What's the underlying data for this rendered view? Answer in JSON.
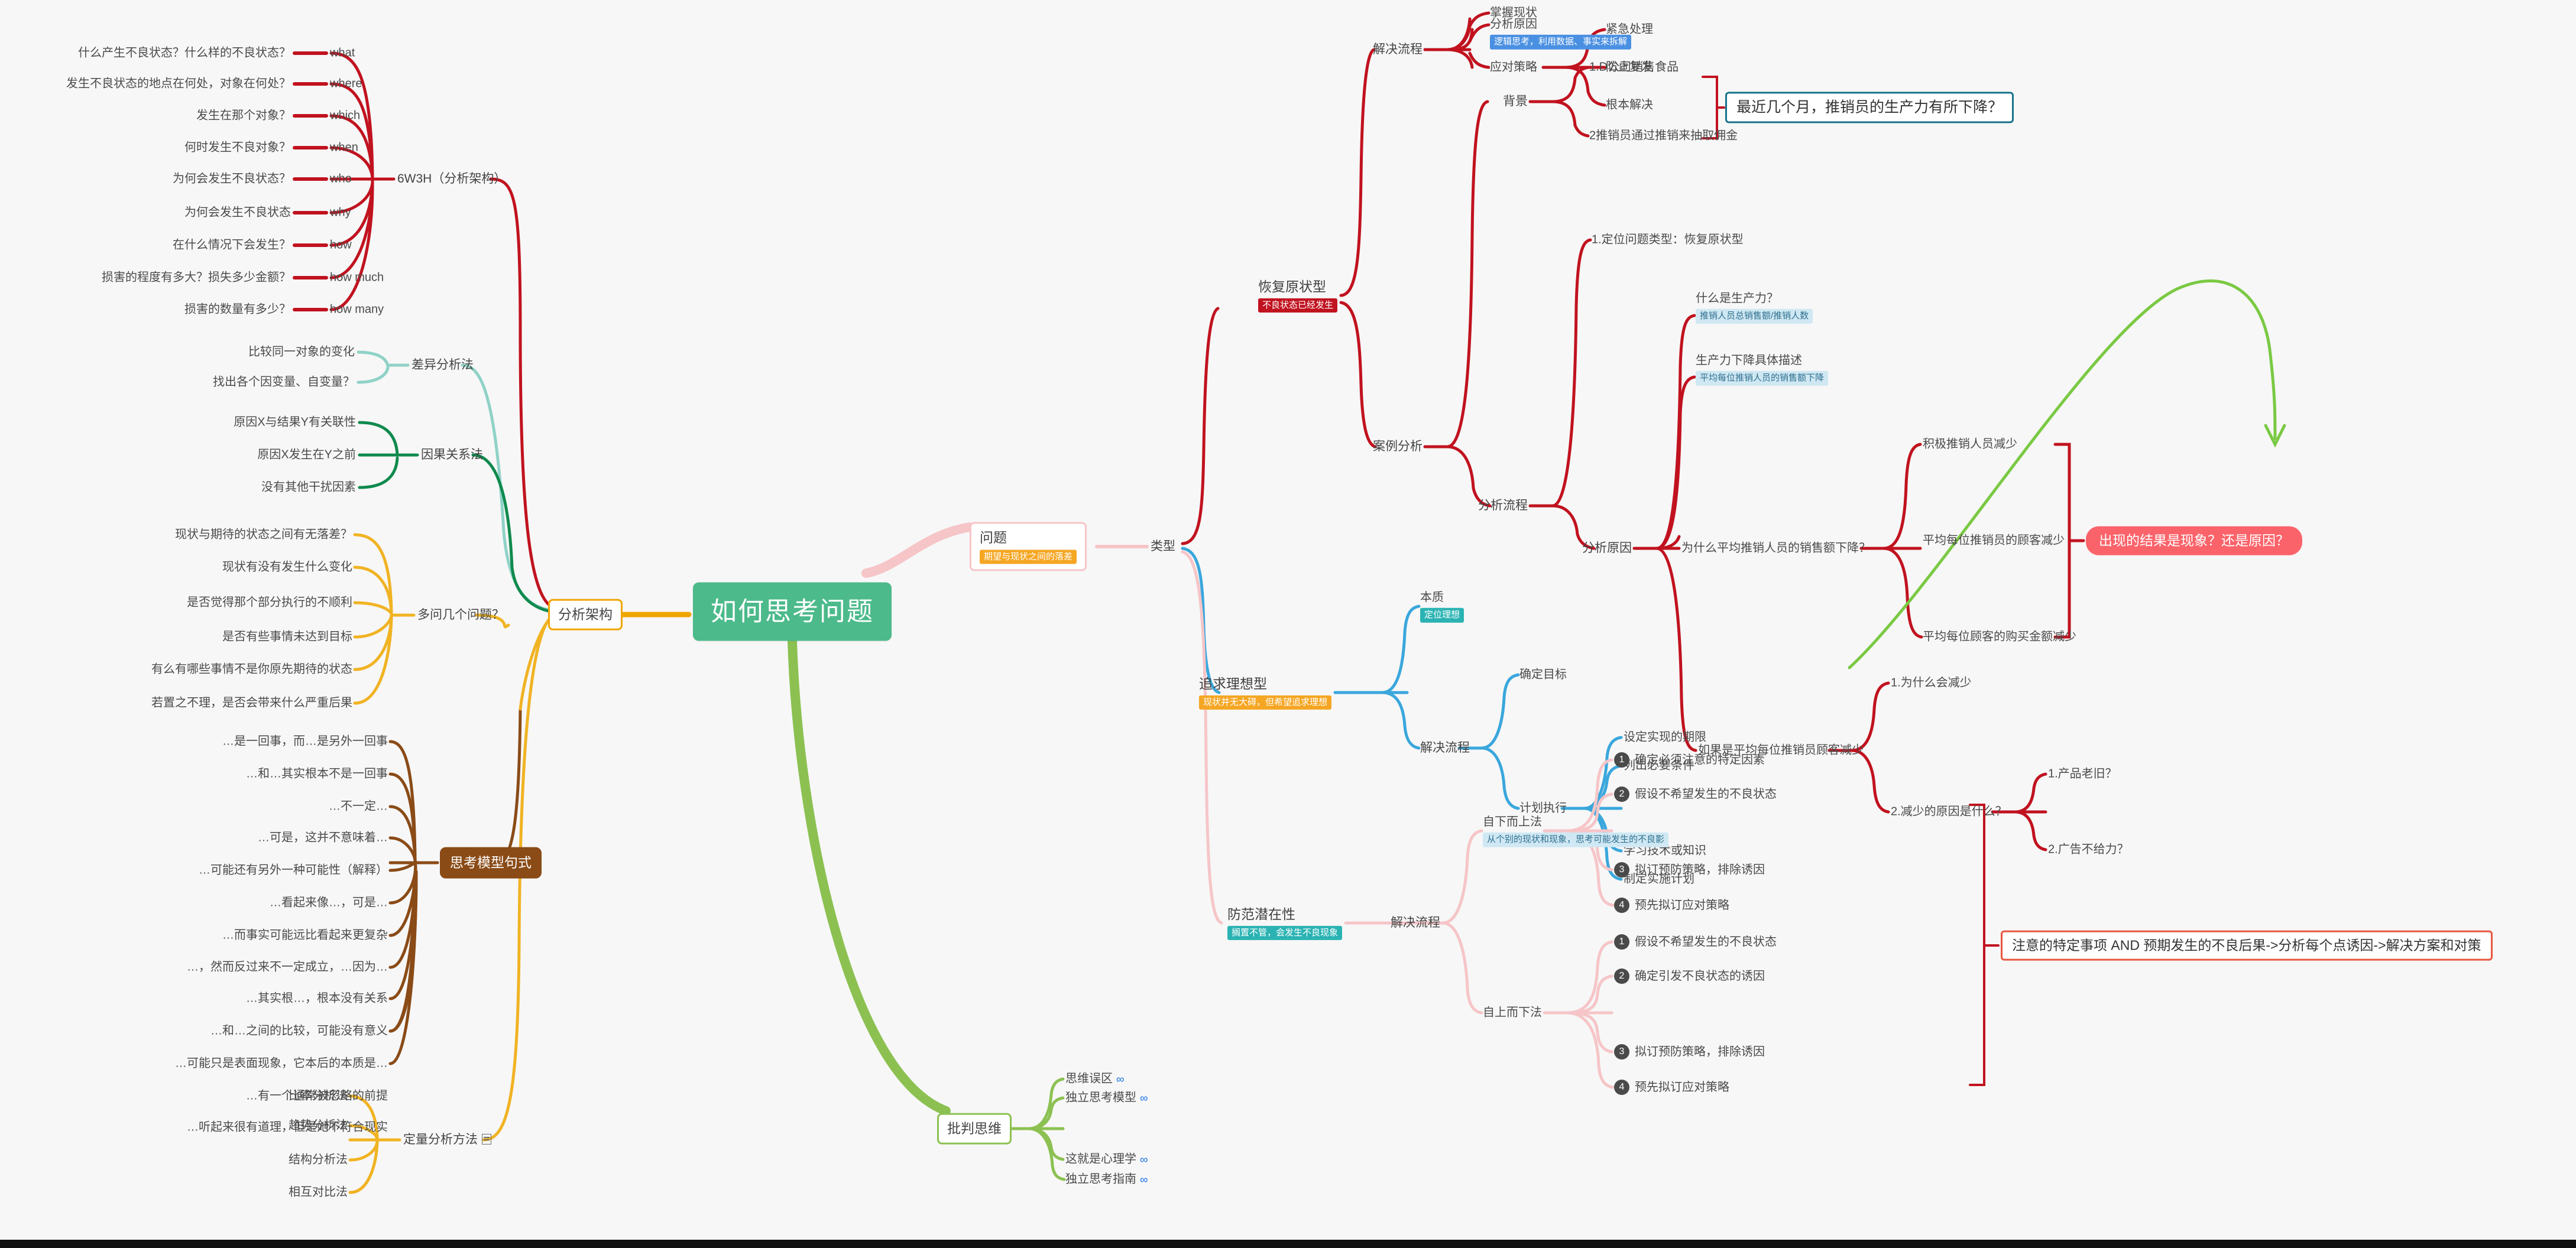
{
  "root": {
    "label": "如何思考问题",
    "color": "#4cba8b"
  },
  "branches": {
    "analysis_framework": {
      "label": "分析架构",
      "color": "#f0a500",
      "groups": [
        {
          "label": "6W3H（分析架构）",
          "color": "#c1121f",
          "items": [
            {
              "key": "what",
              "question": "什么产生不良状态？什么样的不良状态？"
            },
            {
              "key": "where",
              "question": "发生不良状态的地点在何处，对象在何处？"
            },
            {
              "key": "which",
              "question": "发生在那个对象？"
            },
            {
              "key": "when",
              "question": "何时发生不良对象？"
            },
            {
              "key": "who",
              "question": "为何会发生不良状态？"
            },
            {
              "key": "why",
              "question": "为何会发生不良状态"
            },
            {
              "key": "how",
              "question": "在什么情况下会发生？"
            },
            {
              "key": "how much",
              "question": "损害的程度有多大？损失多少金额？"
            },
            {
              "key": "how many",
              "question": "损害的数量有多少？"
            }
          ]
        },
        {
          "label": "差异分析法",
          "color": "#8fd2c7",
          "items": [
            "比较同一对象的变化",
            "找出各个因变量、自变量？"
          ]
        },
        {
          "label": "因果关系法",
          "color": "#0f8a4d",
          "items": [
            "原因X与结果Y有关联性",
            "原因X发生在Y之前",
            "没有其他干扰因素"
          ]
        },
        {
          "label": "多问几个问题？",
          "color": "#f0b323",
          "items": [
            "现状与期待的状态之间有无落差？",
            "现状有没有发生什么变化",
            "是否觉得那个部分执行的不顺利",
            "是否有些事情未达到目标",
            "有么有哪些事情不是你原先期待的状态",
            "若置之不理，是否会带来什么严重后果"
          ]
        },
        {
          "label": "思考模型句式",
          "color": "#8a4b17",
          "items": [
            "…是一回事，而…是另外一回事",
            "…和…其实根本不是一回事",
            "…不一定…",
            "…可是，这并不意味着…",
            "…可能还有另外一种可能性（解释）",
            "…看起来像…，可是…",
            "…而事实可能远比看起来更复杂",
            "…，然而反过来不一定成立，…因为…",
            "…其实根…，根本没有关系",
            "…和…之间的比较，可能没有意义",
            "…可能只是表面现象，它本后的本质是…",
            "…有一个通常被忽略的前提",
            "…听起来很有道理，但是她不符合现实"
          ]
        },
        {
          "label": "定量分析方法",
          "color": "#f0b323",
          "has_list_icon": true,
          "items": [
            "比率分析法",
            "趋势分析法",
            "结构分析法",
            "相互对比法"
          ]
        }
      ]
    },
    "problem": {
      "label": "问题",
      "tag": "期望与现状之间的落差",
      "tag_color": "#f5a623",
      "color": "#f6c5c8",
      "type_label": "类型",
      "types": [
        {
          "label": "恢复原状型",
          "tag": "不良状态已经发生",
          "tag_color": "#c1121f",
          "color": "#c1121f",
          "solve_process": {
            "label": "解决流程",
            "steps": [
              {
                "label": "掌握现状"
              },
              {
                "label": "分析原因",
                "tag": "逻辑思考，利用数据、事实来拆解",
                "tag_color": "#4a90e2"
              },
              {
                "label": "应对策略",
                "children": [
                  "紧急处理",
                  "防止复发",
                  "根本解决"
                ]
              }
            ]
          },
          "case_study": {
            "label": "案例分析",
            "background": {
              "label": "背景",
              "items": [
                "1.D公司销售食品",
                "2推销员通过推销来抽取佣金"
              ],
              "callout": "最近几个月，推销员的生产力有所下降？",
              "callout_color": "#17728c"
            },
            "analysis_flow": {
              "label": "分析流程",
              "step1": "1.定位问题类型：恢复原状型",
              "cause_analysis": {
                "label": "分析原因",
                "items": [
                  {
                    "label": "什么是生产力？",
                    "tag": "推销人员总销售额/推销人数",
                    "tag_color": "#cfe8f3"
                  },
                  {
                    "label": "生产力下降具体描述",
                    "tag": "平均每位推销人员的销售额下降",
                    "tag_color": "#cfe8f3"
                  },
                  {
                    "label": "为什么平均推销人员的销售额下降？",
                    "children": [
                      "积极推销人员减少",
                      "平均每位推销员的顾客减少",
                      "平均每位顾客的购买金额减少"
                    ]
                  },
                  {
                    "label": "如果是平均每位推销员顾客减少",
                    "children_numbered": [
                      "1.为什么会减少",
                      "2.减少的原因是什么？"
                    ],
                    "sub_children": [
                      "1.产品老旧？",
                      "2.广告不给力？"
                    ]
                  }
                ],
                "pill_note": "出现的结果是现象？还是原因？",
                "pill_color": "#fb636a"
              }
            }
          }
        },
        {
          "label": "追求理想型",
          "tag": "现状并无大碍，但希望追求理想",
          "tag_color": "#f5a623",
          "color": "#3aa7dc",
          "essence": {
            "label": "本质",
            "tag": "定位理想",
            "tag_color": "#2bb3b3"
          },
          "solve_process": {
            "label": "解决流程",
            "steps": [
              {
                "label": "确定目标"
              },
              {
                "label": "计划执行",
                "children": [
                  "设定实现的期限",
                  "列出必要条件",
                  "学习技术或知识",
                  "制定实施计划"
                ]
              }
            ]
          }
        },
        {
          "label": "防范潜在性",
          "tag": "搁置不管，会发生不良现象",
          "tag_color": "#2bb3b3",
          "color": "#f6c5c8",
          "solve_process": {
            "label": "解决流程",
            "methods": [
              {
                "label": "自下而上法",
                "tag": "从个别的现状和现象，思考可能发生的不良影",
                "tag_color": "#cfe8f3",
                "steps": [
                  "确定必须注意的特定因素",
                  "假设不希望发生的不良状态",
                  "拟订预防策略，排除诱因",
                  "预先拟订应对策略"
                ]
              },
              {
                "label": "自上而下法",
                "steps": [
                  "假设不希望发生的不良状态",
                  "确定引发不良状态的诱因",
                  "拟订预防策略，排除诱因",
                  "预先拟订应对策略"
                ]
              }
            ],
            "summary": "注意的特定事项 AND 预期发生的不良后果->分析每个点诱因->解决方案和对策",
            "summary_color": "#e8563f"
          }
        }
      ]
    },
    "critical_thinking": {
      "label": "批判思维",
      "color": "#8cc152",
      "items": [
        {
          "label": "思维误区",
          "has_link": true
        },
        {
          "label": "独立思考模型",
          "has_link": true
        },
        {
          "label": "这就是心理学",
          "has_link": true
        },
        {
          "label": "独立思考指南",
          "has_link": true
        }
      ]
    }
  },
  "icons": {
    "link": "∞",
    "list": "list-icon"
  }
}
